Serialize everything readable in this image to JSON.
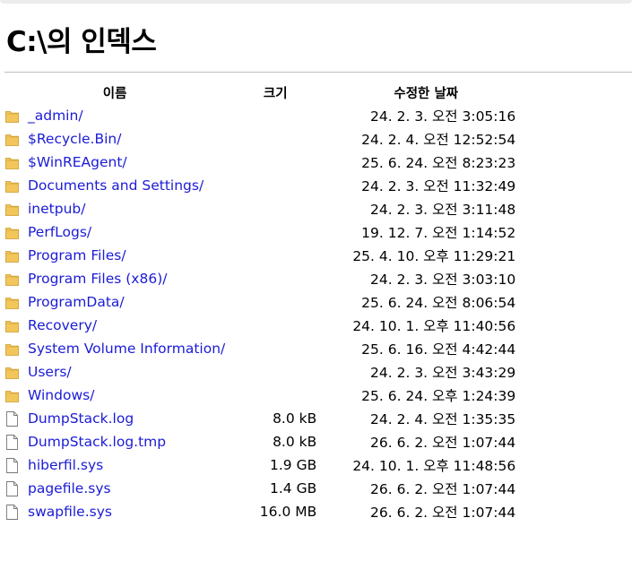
{
  "page": {
    "title": "C:\\의 인덱스"
  },
  "columns": {
    "name": "이름",
    "size": "크기",
    "date": "수정한 날짜"
  },
  "colors": {
    "link": "#1b1bd6",
    "folder": "#f2c65a"
  },
  "entries": [
    {
      "name": "_admin/",
      "size": "",
      "date": "24. 2. 3. 오전 3:05:16",
      "icon": "folder-icon"
    },
    {
      "name": "$Recycle.Bin/",
      "size": "",
      "date": "24. 2. 4. 오전 12:52:54",
      "icon": "folder-icon"
    },
    {
      "name": "$WinREAgent/",
      "size": "",
      "date": "25. 6. 24. 오전 8:23:23",
      "icon": "folder-icon"
    },
    {
      "name": "Documents and Settings/",
      "size": "",
      "date": "24. 2. 3. 오전 11:32:49",
      "icon": "folder-icon"
    },
    {
      "name": "inetpub/",
      "size": "",
      "date": "24. 2. 3. 오전 3:11:48",
      "icon": "folder-icon"
    },
    {
      "name": "PerfLogs/",
      "size": "",
      "date": "19. 12. 7. 오전 1:14:52",
      "icon": "folder-icon"
    },
    {
      "name": "Program Files/",
      "size": "",
      "date": "25. 4. 10. 오후 11:29:21",
      "icon": "folder-icon"
    },
    {
      "name": "Program Files (x86)/",
      "size": "",
      "date": "24. 2. 3. 오전 3:03:10",
      "icon": "folder-icon"
    },
    {
      "name": "ProgramData/",
      "size": "",
      "date": "25. 6. 24. 오전 8:06:54",
      "icon": "folder-icon"
    },
    {
      "name": "Recovery/",
      "size": "",
      "date": "24. 10. 1. 오후 11:40:56",
      "icon": "folder-icon"
    },
    {
      "name": "System Volume Information/",
      "size": "",
      "date": "25. 6. 16. 오전 4:42:44",
      "icon": "folder-icon"
    },
    {
      "name": "Users/",
      "size": "",
      "date": "24. 2. 3. 오전 3:43:29",
      "icon": "folder-icon"
    },
    {
      "name": "Windows/",
      "size": "",
      "date": "25. 6. 24. 오후 1:24:39",
      "icon": "folder-icon"
    },
    {
      "name": "DumpStack.log",
      "size": "8.0 kB",
      "date": "24. 2. 4. 오전 1:35:35",
      "icon": "file-icon"
    },
    {
      "name": "DumpStack.log.tmp",
      "size": "8.0 kB",
      "date": "26. 6. 2. 오전 1:07:44",
      "icon": "file-icon"
    },
    {
      "name": "hiberfil.sys",
      "size": "1.9 GB",
      "date": "24. 10. 1. 오후 11:48:56",
      "icon": "file-icon"
    },
    {
      "name": "pagefile.sys",
      "size": "1.4 GB",
      "date": "26. 6. 2. 오전 1:07:44",
      "icon": "file-icon"
    },
    {
      "name": "swapfile.sys",
      "size": "16.0 MB",
      "date": "26. 6. 2. 오전 1:07:44",
      "icon": "file-icon"
    }
  ]
}
